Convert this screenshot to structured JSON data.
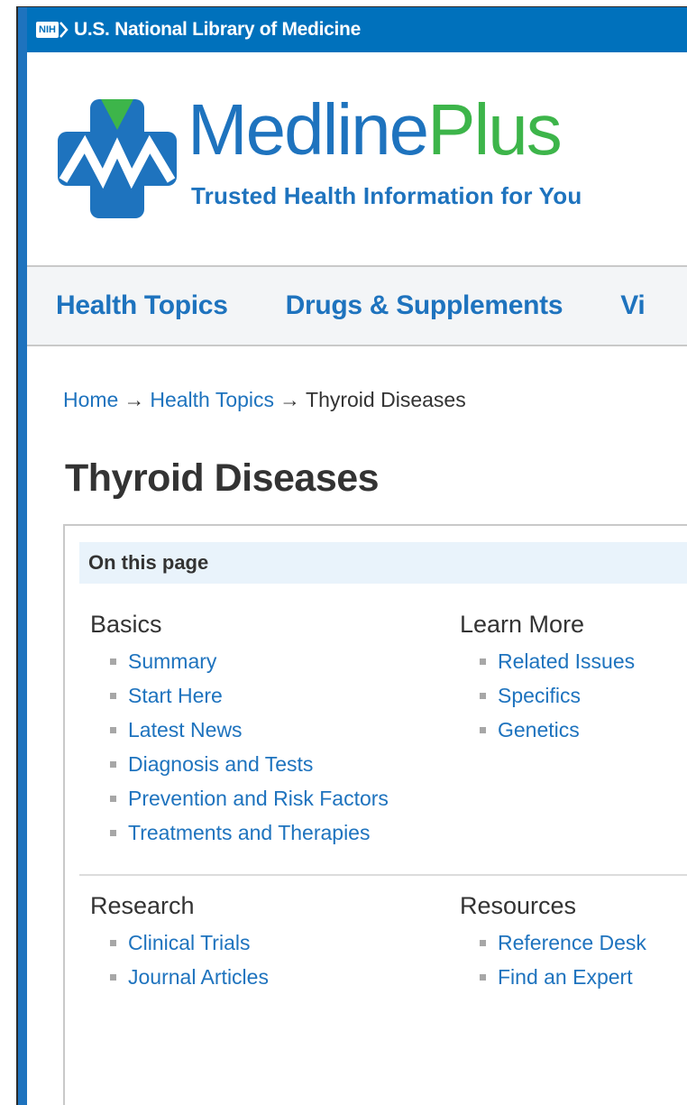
{
  "nih_bar": {
    "badge": "NIH",
    "title": "U.S. National Library of Medicine"
  },
  "logo": {
    "brand_first": "Medline",
    "brand_second": "Plus",
    "tagline": "Trusted Health Information for You",
    "colors": {
      "blue": "#1e73be",
      "green": "#3db54a"
    }
  },
  "nav": {
    "items": [
      {
        "label": "Health Topics"
      },
      {
        "label": "Drugs & Supplements"
      },
      {
        "label": "Vi"
      }
    ]
  },
  "breadcrumb": {
    "home": "Home",
    "arrow": "→",
    "section": "Health Topics",
    "current": "Thyroid Diseases"
  },
  "page_title": "Thyroid Diseases",
  "on_this_page": {
    "header": "On this page",
    "basics": {
      "title": "Basics",
      "links": [
        "Summary",
        "Start Here",
        "Latest News",
        "Diagnosis and Tests",
        "Prevention and Risk Factors",
        "Treatments and Therapies"
      ]
    },
    "learn_more": {
      "title": "Learn More",
      "links": [
        "Related Issues",
        "Specifics",
        "Genetics"
      ]
    },
    "research": {
      "title": "Research",
      "links": [
        "Clinical Trials",
        "Journal Articles"
      ]
    },
    "resources": {
      "title": "Resources",
      "links": [
        "Reference Desk",
        "Find an Expert"
      ]
    }
  }
}
